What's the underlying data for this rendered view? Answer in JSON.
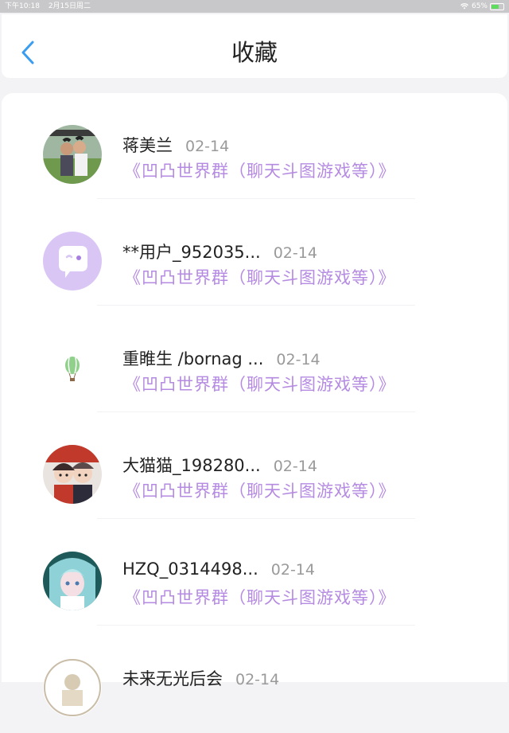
{
  "status": {
    "time": "下午10:18",
    "date": "2月15日周二",
    "battery_text": "65%",
    "battery_level": 0.65
  },
  "header": {
    "title": "收藏"
  },
  "items": [
    {
      "name": "蒋美兰",
      "date": "02-14",
      "desc": "《凹凸世界群（聊天斗图游戏等）》",
      "avatar": "photo-children-avatar"
    },
    {
      "name": "**用户_952035...",
      "date": "02-14",
      "desc": "《凹凸世界群（聊天斗图游戏等）》",
      "avatar": "chat-bubble-avatar"
    },
    {
      "name": "重睢生 /bornag ...",
      "date": "02-14",
      "desc": "《凹凸世界群（聊天斗图游戏等）》",
      "avatar": "hot-air-balloon-avatar"
    },
    {
      "name": "大猫猫_198280...",
      "date": "02-14",
      "desc": "《凹凸世界群（聊天斗图游戏等）》",
      "avatar": "anime-boys-avatar"
    },
    {
      "name": "HZQ_0314498...",
      "date": "02-14",
      "desc": "《凹凸世界群（聊天斗图游戏等）》",
      "avatar": "anime-girl-avatar"
    },
    {
      "name": "未来无光后会",
      "date": "02-14",
      "desc": "",
      "avatar": "round-badge-avatar"
    }
  ],
  "colors": {
    "accent_blue": "#3a9df0",
    "desc_purple": "#b58be2",
    "date_gray": "#9a9a9a"
  }
}
